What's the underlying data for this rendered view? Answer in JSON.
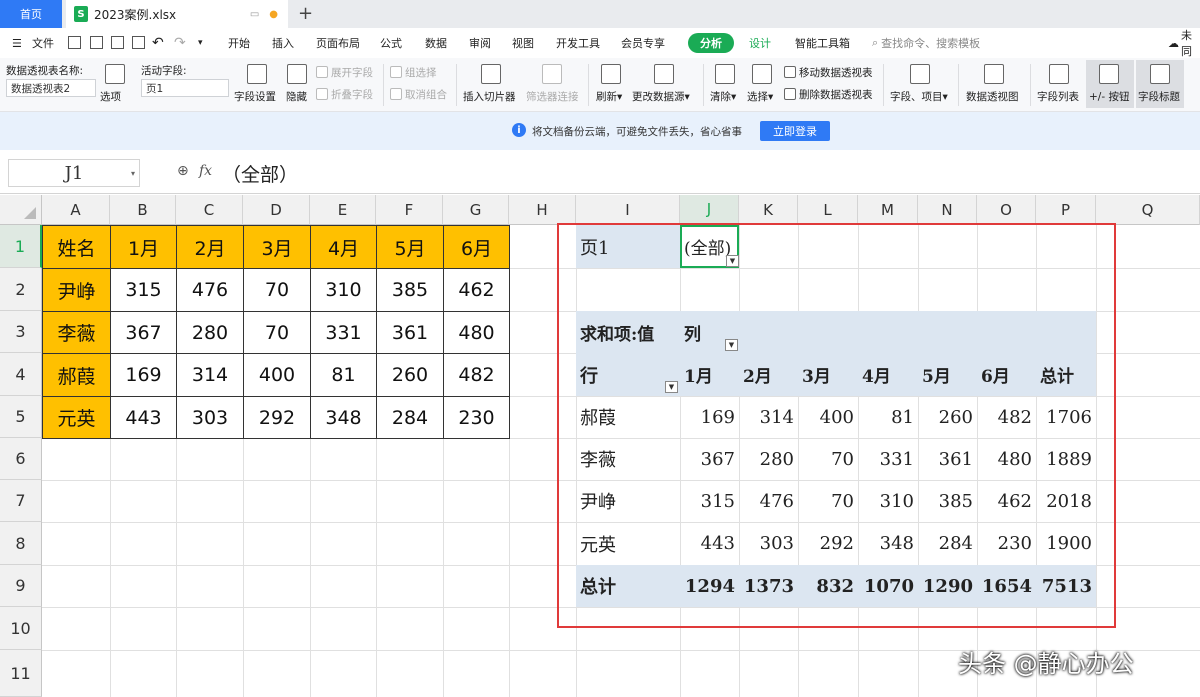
{
  "tabs": {
    "home": "首页",
    "file": "2023案例.xlsx"
  },
  "menu": {
    "file": "文件",
    "items": [
      "开始",
      "插入",
      "页面布局",
      "公式",
      "数据",
      "审阅",
      "视图",
      "开发工具",
      "会员专享"
    ],
    "analysis": "分析",
    "design": "设计",
    "smart_tools": "智能工具箱",
    "search": "查找命令、搜索模板",
    "cloud": "未同"
  },
  "ribbon": {
    "pivot_name_label": "数据透视表名称:",
    "pivot_name_value": "数据透视表2",
    "options": "选项",
    "active_field_label": "活动字段:",
    "active_field_value": "页1",
    "field_settings": "字段设置",
    "hide": "隐藏",
    "expand_field": "展开字段",
    "collapse_field": "折叠字段",
    "group_selection": "组选择",
    "ungroup": "取消组合",
    "insert_slicer": "插入切片器",
    "filter_connections": "筛选器连接",
    "refresh": "刷新",
    "change_source": "更改数据源",
    "clear": "清除",
    "select": "选择",
    "move_pivot": "移动数据透视表",
    "delete_pivot": "删除数据透视表",
    "fields_items": "字段、项目",
    "pivot_chart": "数据透视图",
    "field_list": "字段列表",
    "plus_minus": "+/- 按钮",
    "field_headers": "字段标题"
  },
  "notice": {
    "text": "将文档备份云端，可避免文件丢失，省心省事",
    "button": "立即登录"
  },
  "formula_bar": {
    "name_box": "J1",
    "fx": "fx",
    "content": "（全部）"
  },
  "columns": [
    "A",
    "B",
    "C",
    "D",
    "E",
    "F",
    "G",
    "H",
    "I",
    "J",
    "K",
    "L",
    "M",
    "N",
    "O",
    "P",
    "Q"
  ],
  "rows": [
    "1",
    "2",
    "3",
    "4",
    "5",
    "6",
    "7",
    "8",
    "9",
    "10",
    "11"
  ],
  "source_table": {
    "header": [
      "姓名",
      "1月",
      "2月",
      "3月",
      "4月",
      "5月",
      "6月"
    ],
    "data": [
      [
        "尹峥",
        "315",
        "476",
        "70",
        "310",
        "385",
        "462"
      ],
      [
        "李薇",
        "367",
        "280",
        "70",
        "331",
        "361",
        "480"
      ],
      [
        "郝葭",
        "169",
        "314",
        "400",
        "81",
        "260",
        "482"
      ],
      [
        "元英",
        "443",
        "303",
        "292",
        "348",
        "284",
        "230"
      ]
    ]
  },
  "pivot": {
    "page_label": "页1",
    "page_value": "(全部)",
    "value_label": "求和项:值",
    "column_label": "列",
    "row_label": "行",
    "headers": [
      "1月",
      "2月",
      "3月",
      "4月",
      "5月",
      "6月",
      "总计"
    ],
    "rows": [
      [
        "郝葭",
        "169",
        "314",
        "400",
        "81",
        "260",
        "482",
        "1706"
      ],
      [
        "李薇",
        "367",
        "280",
        "70",
        "331",
        "361",
        "480",
        "1889"
      ],
      [
        "尹峥",
        "315",
        "476",
        "70",
        "310",
        "385",
        "462",
        "2018"
      ],
      [
        "元英",
        "443",
        "303",
        "292",
        "348",
        "284",
        "230",
        "1900"
      ]
    ],
    "total_label": "总计",
    "totals": [
      "1294",
      "1373",
      "832",
      "1070",
      "1290",
      "1654",
      "7513"
    ]
  },
  "watermark": "头条 @静心办公"
}
